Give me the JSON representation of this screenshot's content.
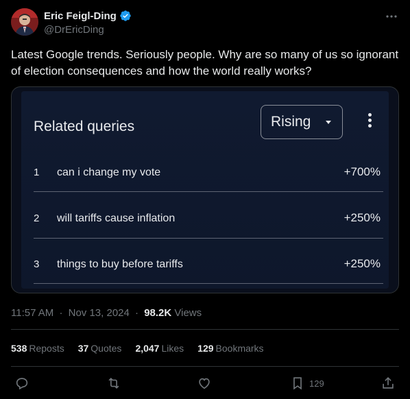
{
  "author": {
    "display_name": "Eric Feigl-Ding",
    "handle": "@DrEricDing",
    "avatar_icon": "profile-photo",
    "verified_color": "#1d9bf0"
  },
  "tweet": {
    "text": "Latest Google trends. Seriously people. Why are so many of us so ignorant of election consequences and how the world really works?"
  },
  "embedded_image": {
    "panel_title": "Related queries",
    "dropdown_value": "Rising",
    "queries": [
      {
        "rank": "1",
        "query": "can i change my vote",
        "change": "+700%"
      },
      {
        "rank": "2",
        "query": "will tariffs cause inflation",
        "change": "+250%"
      },
      {
        "rank": "3",
        "query": "things to buy before tariffs",
        "change": "+250%"
      }
    ]
  },
  "meta": {
    "time": "11:57 AM",
    "date": "Nov 13, 2024",
    "separator": "·",
    "views_count": "98.2K",
    "views_label": "Views"
  },
  "stats": {
    "reposts_count": "538",
    "reposts_label": "Reposts",
    "quotes_count": "37",
    "quotes_label": "Quotes",
    "likes_count": "2,047",
    "likes_label": "Likes",
    "bookmarks_count": "129",
    "bookmarks_label": "Bookmarks"
  },
  "actions": {
    "bookmark_count": "129"
  },
  "colors": {
    "background": "#000000",
    "text_primary": "#e7e9ea",
    "text_secondary": "#71767b",
    "border": "#2f3336"
  }
}
